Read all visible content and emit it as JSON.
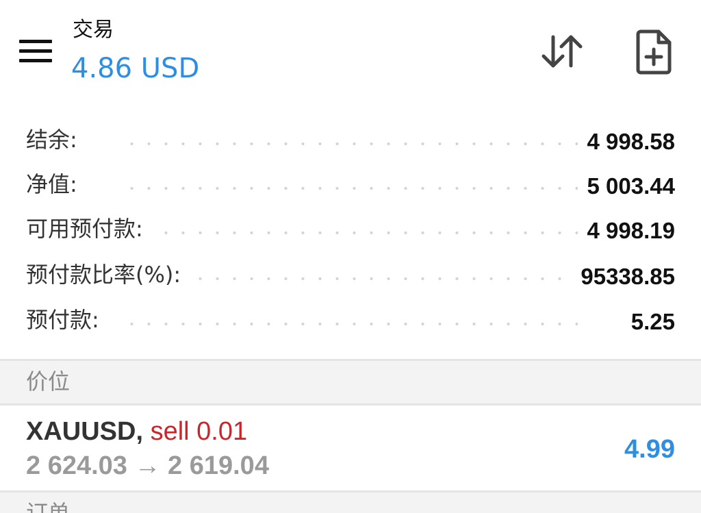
{
  "header": {
    "title": "交易",
    "profit": "4.86 USD",
    "icons": {
      "menu": "hamburger-menu-icon",
      "sort": "sort-arrows-icon",
      "new_order": "file-plus-icon"
    }
  },
  "account": {
    "rows": [
      {
        "label": "结余:",
        "value": "4 998.58"
      },
      {
        "label": "净值:",
        "value": "5 003.44"
      },
      {
        "label": "可用预付款:",
        "value": "4 998.19"
      },
      {
        "label": "预付款比率(%):",
        "value": "95338.85"
      },
      {
        "label": "预付款:",
        "value": "5.25"
      }
    ]
  },
  "sections": {
    "positions": "价位",
    "orders": "订单"
  },
  "positions": [
    {
      "symbol": "XAUUSD,",
      "side": "sell 0.01",
      "prices": "2 624.03 → 2 619.04",
      "profit": "4.99"
    }
  ],
  "colors": {
    "accent": "#2d8ee2",
    "sell": "#c8262c",
    "section_bg": "#f3f3f3",
    "muted": "#9a9a9a"
  }
}
